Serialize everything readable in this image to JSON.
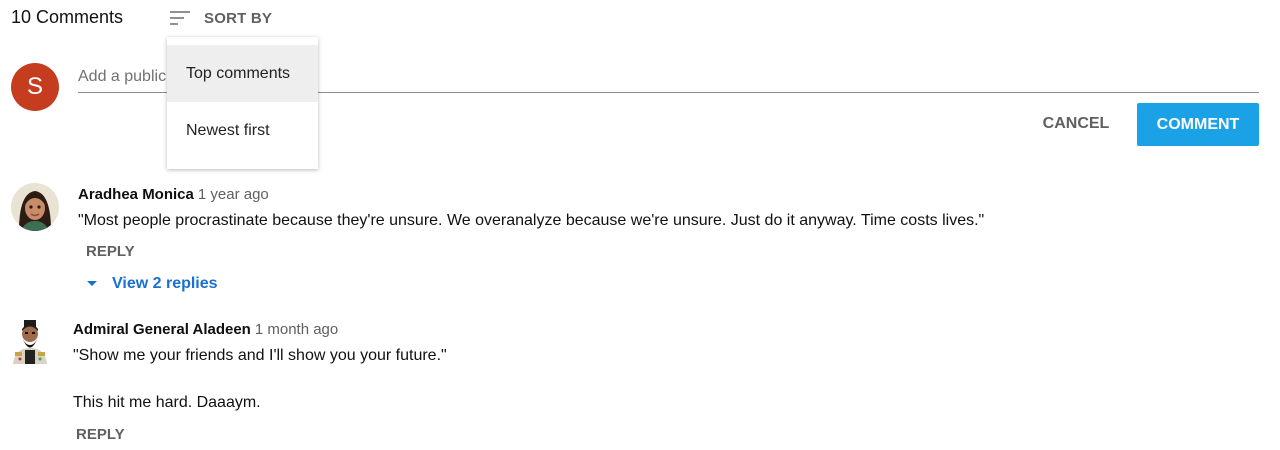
{
  "header": {
    "comment_count": "10 Comments",
    "sort_label": "SORT BY",
    "sort_icon": "sort-lines-icon"
  },
  "sort_menu": {
    "items": [
      {
        "label": "Top comments",
        "selected": true
      },
      {
        "label": "Newest first",
        "selected": false
      }
    ]
  },
  "add_comment": {
    "avatar_letter": "S",
    "avatar_color": "#c53d1e",
    "placeholder": "Add a public comment...",
    "cancel_label": "CANCEL",
    "submit_label": "COMMENT",
    "submit_color": "#1ba1e6"
  },
  "comments": [
    {
      "author": "Aradhea Monica",
      "time": "1 year ago",
      "text": "\"Most people procrastinate because they're unsure. We overanalyze because we're unsure. Just do it anyway. Time costs lives.\"",
      "reply_label": "REPLY",
      "view_replies": "View 2 replies"
    },
    {
      "author": "Admiral General Aladeen",
      "time": "1 month ago",
      "text_lines": [
        "\"Show me your friends and I'll show you your future.\"",
        "This hit me hard. Daaaym."
      ],
      "reply_label": "REPLY"
    }
  ],
  "colors": {
    "link_blue": "#1a6fd0",
    "muted_text": "#606060"
  }
}
